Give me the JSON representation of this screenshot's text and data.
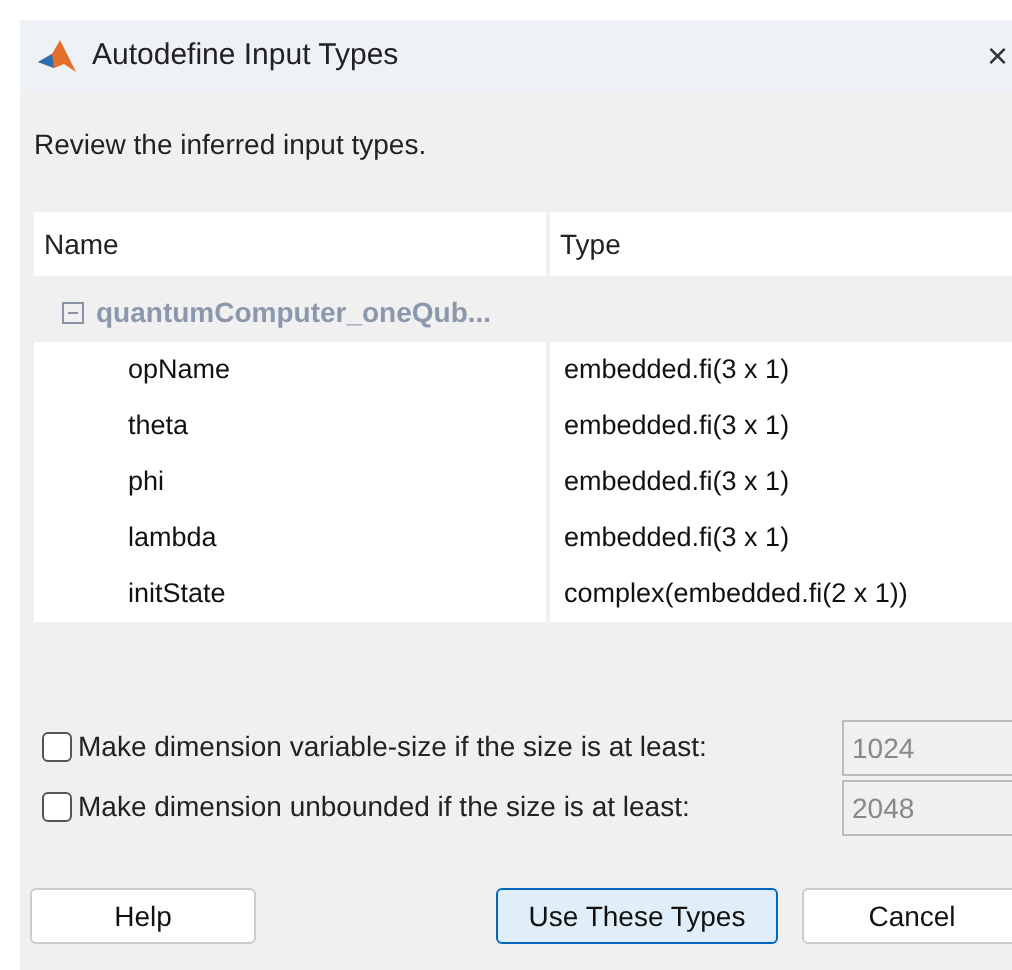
{
  "window": {
    "title": "Autodefine Input Types",
    "close": "×"
  },
  "instruction": "Review the inferred input types.",
  "table": {
    "columns": [
      "Name",
      "Type"
    ],
    "group": {
      "label": "quantumComputer_oneQub...",
      "expanded": true
    },
    "rows": [
      {
        "name": "opName",
        "type": "embedded.fi(3 x 1)"
      },
      {
        "name": "theta",
        "type": "embedded.fi(3 x 1)"
      },
      {
        "name": "phi",
        "type": "embedded.fi(3 x 1)"
      },
      {
        "name": "lambda",
        "type": "embedded.fi(3 x 1)"
      },
      {
        "name": "initState",
        "type": "complex(embedded.fi(2 x 1))"
      }
    ]
  },
  "options": [
    {
      "label": "Make dimension variable-size if the size is at least:",
      "checked": false,
      "value": "1024",
      "disabled": true
    },
    {
      "label": "Make dimension unbounded if the size is at least:",
      "checked": false,
      "value": "2048",
      "disabled": true
    }
  ],
  "buttons": [
    {
      "label": "Help",
      "selected": false
    },
    {
      "label": "Use These Types",
      "selected": true
    },
    {
      "label": "Cancel",
      "selected": false
    }
  ]
}
